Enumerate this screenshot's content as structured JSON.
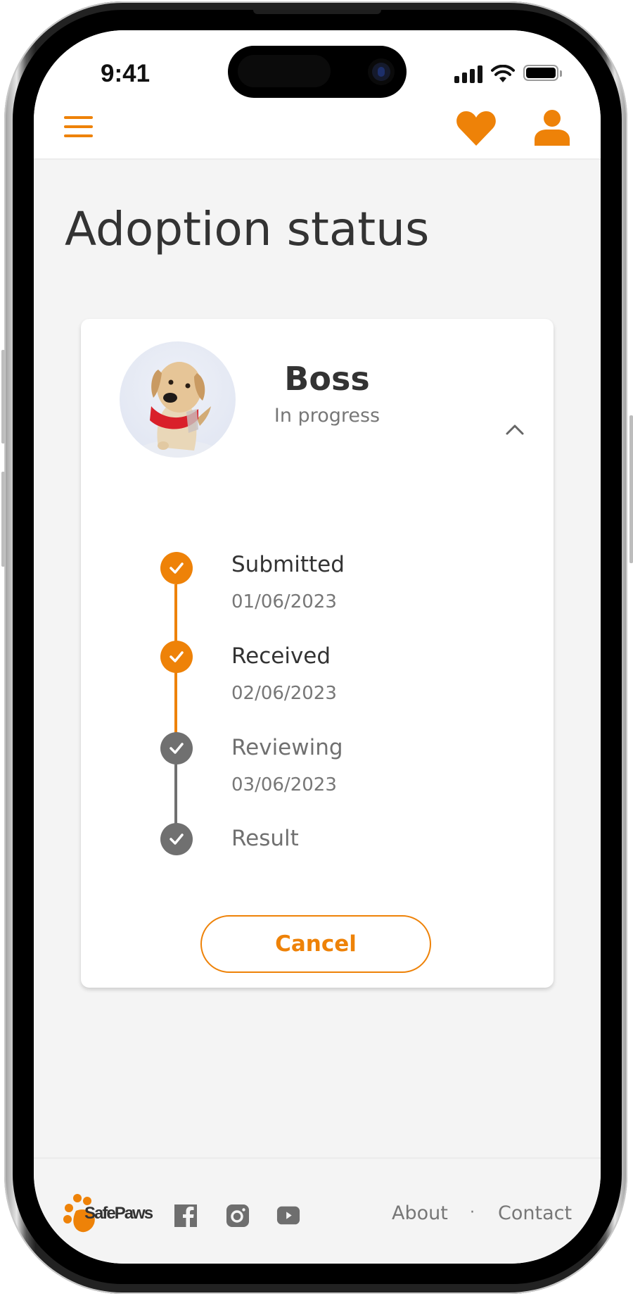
{
  "status_bar": {
    "time": "9:41",
    "icons": [
      "signal-icon",
      "wifi-icon",
      "battery-icon"
    ]
  },
  "header": {
    "menu_icon": "hamburger-menu-icon",
    "favorites_icon": "heart-icon",
    "profile_icon": "user-icon"
  },
  "page": {
    "title": "Adoption status"
  },
  "adoption": {
    "pet_name": "Boss",
    "status": "In progress",
    "avatar_alt": "Dog photo",
    "toggle_icon": "chevron-up-icon",
    "steps": [
      {
        "label": "Submitted",
        "date": "01/06/2023",
        "state": "done"
      },
      {
        "label": "Received",
        "date": "02/06/2023",
        "state": "done"
      },
      {
        "label": "Reviewing",
        "date": "03/06/2023",
        "state": "pending"
      },
      {
        "label": "Result",
        "date": "",
        "state": "pending"
      }
    ],
    "cancel_label": "Cancel"
  },
  "footer": {
    "brand": "SafePaws",
    "social": [
      "facebook-icon",
      "instagram-icon",
      "youtube-icon"
    ],
    "links": {
      "about": "About",
      "separator": "·",
      "contact": "Contact"
    }
  },
  "colors": {
    "accent": "#EE8208",
    "step_pending": "#707070",
    "text_primary": "#333333",
    "text_secondary": "#777777",
    "background": "#F4F4F4"
  }
}
